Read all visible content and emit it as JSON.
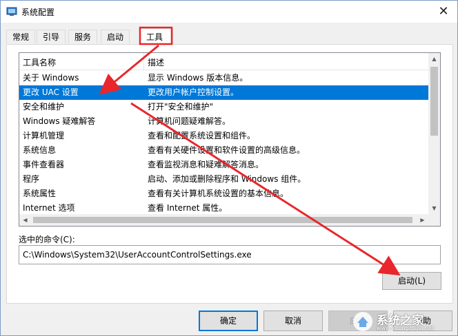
{
  "window": {
    "title": "系统配置",
    "close_glyph": "✕"
  },
  "tabs": [
    {
      "label": "常规"
    },
    {
      "label": "引导"
    },
    {
      "label": "服务"
    },
    {
      "label": "启动"
    },
    {
      "label": "工具",
      "active": true
    }
  ],
  "tools": {
    "columns": [
      "工具名称",
      "描述"
    ],
    "rows": [
      {
        "name": "关于 Windows",
        "desc": "显示 Windows 版本信息。"
      },
      {
        "name": "更改 UAC 设置",
        "desc": "更改用户帐户控制设置。",
        "selected": true
      },
      {
        "name": "安全和维护",
        "desc": "打开\"安全和维护\""
      },
      {
        "name": "Windows 疑难解答",
        "desc": "计算机问题疑难解答。"
      },
      {
        "name": "计算机管理",
        "desc": "查看和配置系统设置和组件。"
      },
      {
        "name": "系统信息",
        "desc": "查看有关硬件设置和软件设置的高级信息。"
      },
      {
        "name": "事件查看器",
        "desc": "查看监视消息和疑难解答消息。"
      },
      {
        "name": "程序",
        "desc": "启动、添加或删除程序和 Windows 组件。"
      },
      {
        "name": "系统属性",
        "desc": "查看有关计算机系统设置的基本信息。"
      },
      {
        "name": "Internet 选项",
        "desc": "查看 Internet 属性。"
      }
    ]
  },
  "command": {
    "label": "选中的命令(C):",
    "value": "C:\\Windows\\System32\\UserAccountControlSettings.exe",
    "launch_label": "启动(L)"
  },
  "footer": {
    "ok": "确定",
    "cancel": "取消",
    "apply": "应用",
    "help": "帮助"
  },
  "watermark": {
    "text": "系统之家",
    "url": "www.xitongzhijia.net"
  },
  "colors": {
    "selection": "#0078d7",
    "annotation": "#e8262b",
    "window_bg": "#f0f0f0"
  }
}
